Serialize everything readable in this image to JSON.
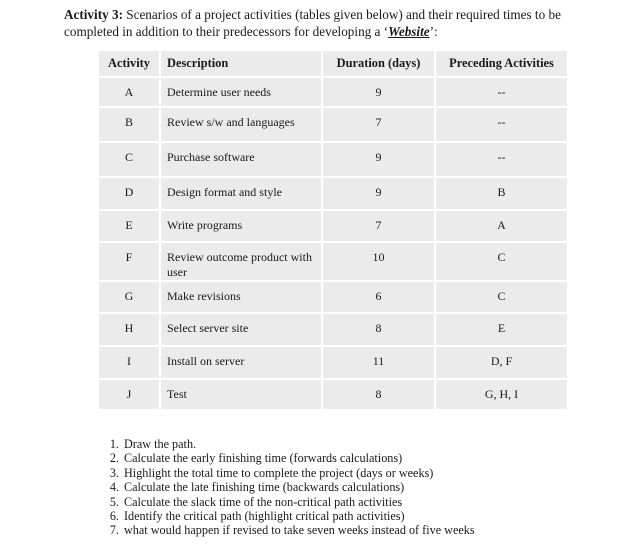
{
  "intro": {
    "label": "Activity 3:",
    "text_before": " Scenarios of a project activities (tables given below) and their required times to be completed in addition to their predecessors for developing a ‘",
    "site": "Website",
    "text_after": "’:"
  },
  "table": {
    "headers": [
      "Activity",
      "Description",
      "Duration (days)",
      "Preceding Activities"
    ],
    "rows": [
      {
        "activity": "A",
        "description": "Determine user needs",
        "duration": "9",
        "preceding": "--"
      },
      {
        "activity": "B",
        "description": "Review s/w and languages",
        "duration": "7",
        "preceding": "--"
      },
      {
        "activity": "C",
        "description": "Purchase software",
        "duration": "9",
        "preceding": "--"
      },
      {
        "activity": "D",
        "description": "Design format and style",
        "duration": "9",
        "preceding": "B"
      },
      {
        "activity": "E",
        "description": "Write programs",
        "duration": "7",
        "preceding": "A"
      },
      {
        "activity": "F",
        "description": "Review outcome product with user",
        "duration": "10",
        "preceding": "C"
      },
      {
        "activity": "G",
        "description": "Make revisions",
        "duration": "6",
        "preceding": "C"
      },
      {
        "activity": "H",
        "description": "Select server site",
        "duration": "8",
        "preceding": "E"
      },
      {
        "activity": "I",
        "description": "Install on server",
        "duration": "11",
        "preceding": "D, F"
      },
      {
        "activity": "J",
        "description": "Test",
        "duration": "8",
        "preceding": "G, H, I"
      }
    ]
  },
  "tasks": [
    "Draw the path.",
    "Calculate the early finishing time (forwards calculations)",
    "Highlight the total time to complete the project (days or weeks)",
    "Calculate the late finishing time (backwards calculations)",
    "Calculate the slack time of the non-critical path activities",
    "Identify the critical path (highlight critical path activities)",
    "what would happen if revised to take seven weeks instead of five weeks"
  ]
}
